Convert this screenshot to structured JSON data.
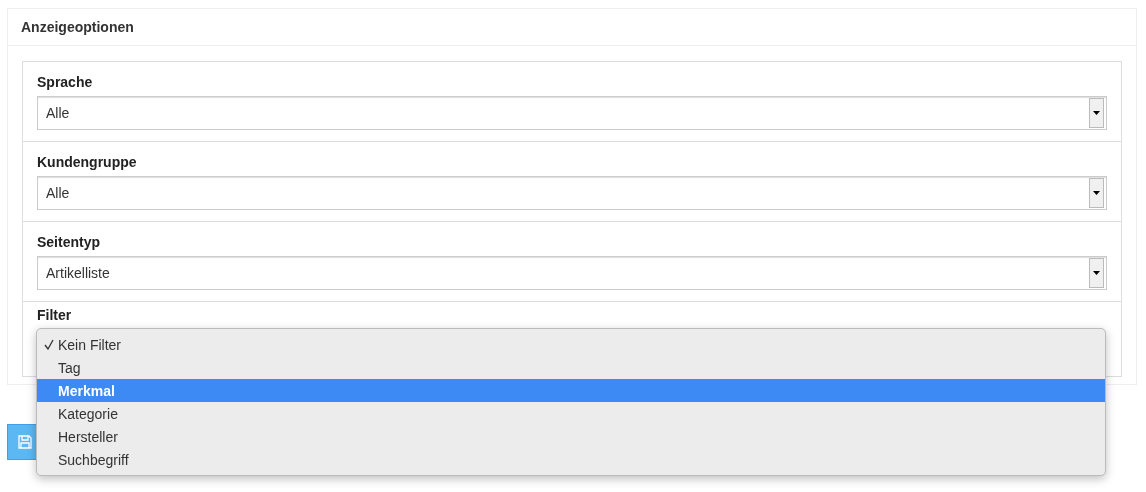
{
  "panel": {
    "title": "Anzeigeoptionen"
  },
  "fields": [
    {
      "label": "Sprache",
      "value": "Alle"
    },
    {
      "label": "Kundengruppe",
      "value": "Alle"
    },
    {
      "label": "Seitentyp",
      "value": "Artikelliste"
    }
  ],
  "filter": {
    "label": "Filter",
    "options": [
      {
        "label": "Kein Filter",
        "selected": true,
        "highlighted": false
      },
      {
        "label": "Tag",
        "selected": false,
        "highlighted": false
      },
      {
        "label": "Merkmal",
        "selected": false,
        "highlighted": true
      },
      {
        "label": "Kategorie",
        "selected": false,
        "highlighted": false
      },
      {
        "label": "Hersteller",
        "selected": false,
        "highlighted": false
      },
      {
        "label": "Suchbegriff",
        "selected": false,
        "highlighted": false
      }
    ]
  }
}
